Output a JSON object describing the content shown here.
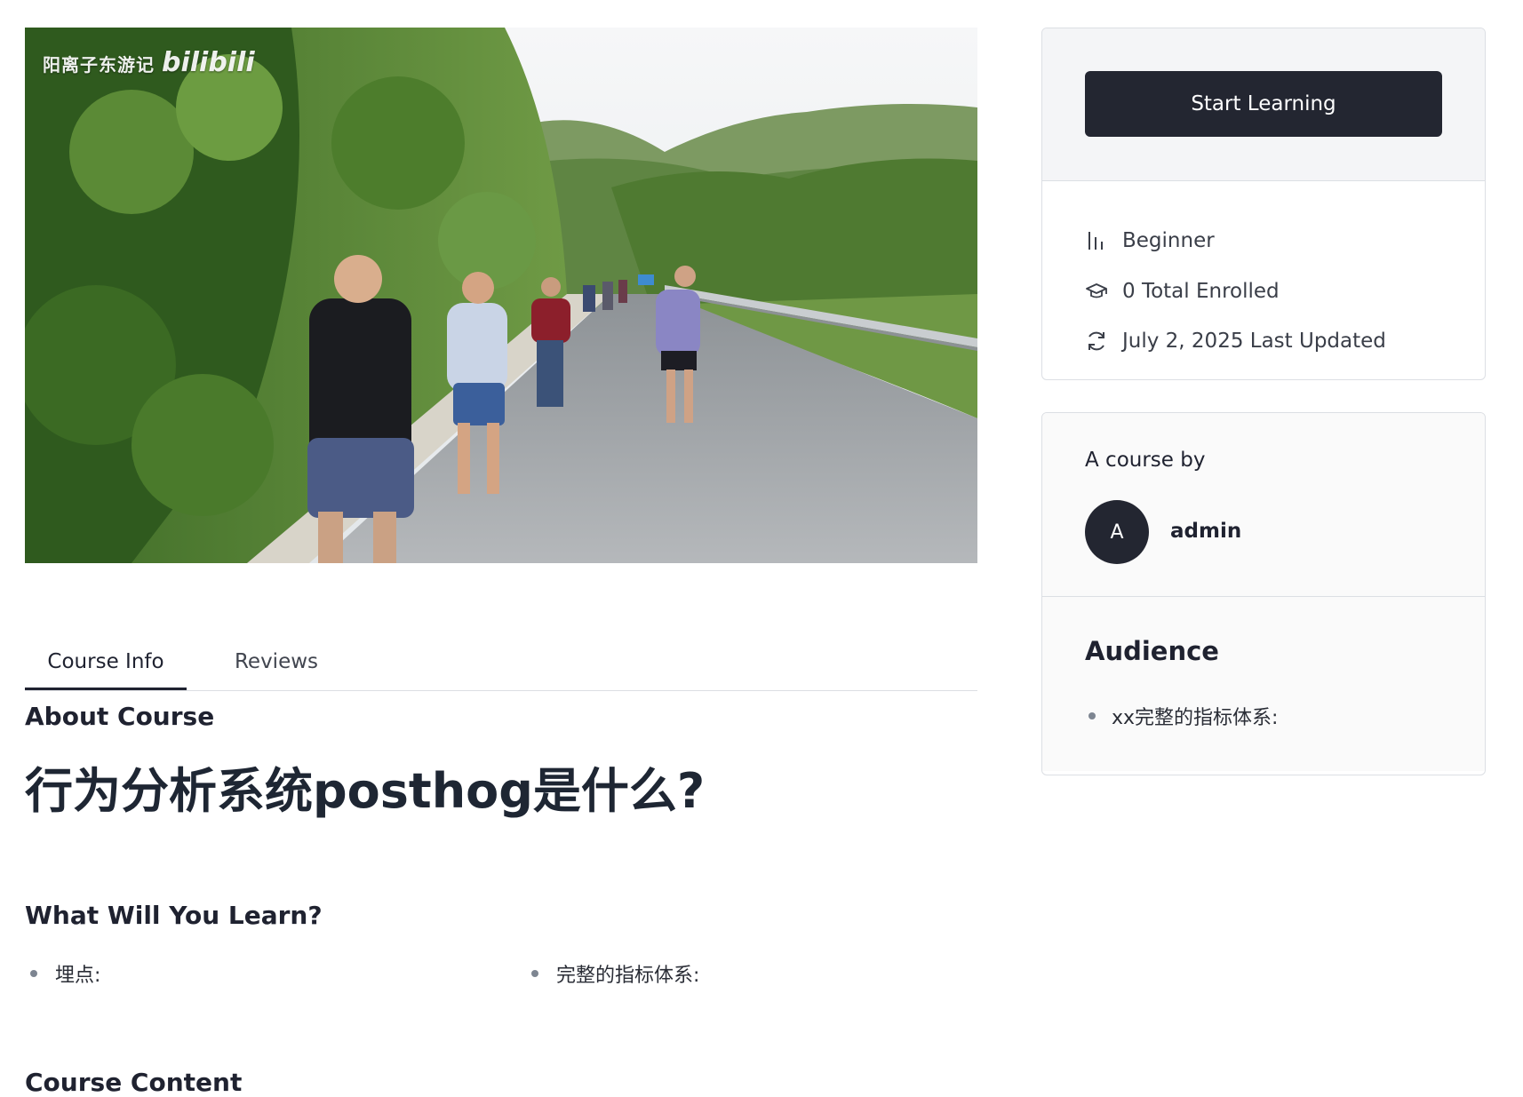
{
  "video": {
    "watermark_text": "阳离子东游记",
    "watermark_brand": "bilibili"
  },
  "tabs": [
    {
      "label": "Course Info",
      "active": true
    },
    {
      "label": "Reviews",
      "active": false
    }
  ],
  "about": {
    "heading": "About Course",
    "title": "行为分析系统posthog是什么?"
  },
  "learn": {
    "heading": "What Will You Learn?",
    "items": [
      "埋点:",
      "完整的指标体系:"
    ]
  },
  "content": {
    "heading": "Course Content"
  },
  "sidebar": {
    "start_button": "Start Learning",
    "meta": {
      "level": "Beginner",
      "enrolled": "0 Total Enrolled",
      "updated": "July 2, 2025 Last Updated"
    },
    "author": {
      "by_label": "A course by",
      "avatar_initial": "A",
      "name": "admin"
    },
    "audience": {
      "heading": "Audience",
      "items": [
        "xx完整的指标体系:"
      ]
    }
  },
  "colors": {
    "primary_button": "#232631",
    "text": "#1f2230",
    "border": "#dcdfe4"
  }
}
